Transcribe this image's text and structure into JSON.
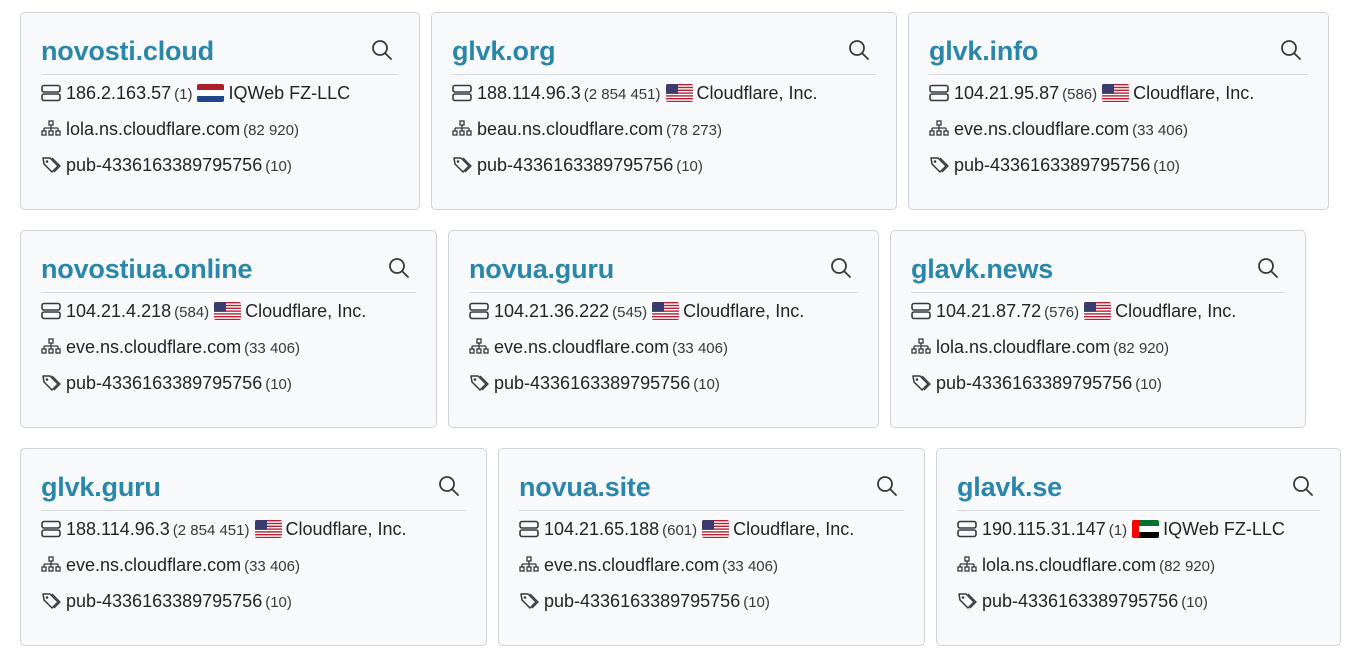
{
  "cards": [
    {
      "domain": "novosti.cloud",
      "ip": "186.2.163.57",
      "ip_count": "(1)",
      "flag": "nl-flag-icon",
      "provider": "IQWeb FZ-LLC",
      "ns": "lola.ns.cloudflare.com",
      "ns_count": "(82 920)",
      "pub": "pub-4336163389795756",
      "pub_count": "(10)"
    },
    {
      "domain": "glvk.org",
      "ip": "188.114.96.3",
      "ip_count": "(2 854 451)",
      "flag": "us-flag-icon",
      "provider": "Cloudflare, Inc.",
      "ns": "beau.ns.cloudflare.com",
      "ns_count": "(78 273)",
      "pub": "pub-4336163389795756",
      "pub_count": "(10)"
    },
    {
      "domain": "glvk.info",
      "ip": "104.21.95.87",
      "ip_count": "(586)",
      "flag": "us-flag-icon",
      "provider": "Cloudflare, Inc.",
      "ns": "eve.ns.cloudflare.com",
      "ns_count": "(33 406)",
      "pub": "pub-4336163389795756",
      "pub_count": "(10)"
    },
    {
      "domain": "novostiua.online",
      "ip": "104.21.4.218",
      "ip_count": "(584)",
      "flag": "us-flag-icon",
      "provider": "Cloudflare, Inc.",
      "ns": "eve.ns.cloudflare.com",
      "ns_count": "(33 406)",
      "pub": "pub-4336163389795756",
      "pub_count": "(10)"
    },
    {
      "domain": "novua.guru",
      "ip": "104.21.36.222",
      "ip_count": "(545)",
      "flag": "us-flag-icon",
      "provider": "Cloudflare, Inc.",
      "ns": "eve.ns.cloudflare.com",
      "ns_count": "(33 406)",
      "pub": "pub-4336163389795756",
      "pub_count": "(10)"
    },
    {
      "domain": "glavk.news",
      "ip": "104.21.87.72",
      "ip_count": "(576)",
      "flag": "us-flag-icon",
      "provider": "Cloudflare, Inc.",
      "ns": "lola.ns.cloudflare.com",
      "ns_count": "(82 920)",
      "pub": "pub-4336163389795756",
      "pub_count": "(10)"
    },
    {
      "domain": "glvk.guru",
      "ip": "188.114.96.3",
      "ip_count": "(2 854 451)",
      "flag": "us-flag-icon",
      "provider": "Cloudflare, Inc.",
      "ns": "eve.ns.cloudflare.com",
      "ns_count": "(33 406)",
      "pub": "pub-4336163389795756",
      "pub_count": "(10)"
    },
    {
      "domain": "novua.site",
      "ip": "104.21.65.188",
      "ip_count": "(601)",
      "flag": "us-flag-icon",
      "provider": "Cloudflare, Inc.",
      "ns": "eve.ns.cloudflare.com",
      "ns_count": "(33 406)",
      "pub": "pub-4336163389795756",
      "pub_count": "(10)"
    },
    {
      "domain": "glavk.se",
      "ip": "190.115.31.147",
      "ip_count": "(1)",
      "flag": "ae-flag-icon",
      "provider": "IQWeb FZ-LLC",
      "ns": "lola.ns.cloudflare.com",
      "ns_count": "(82 920)",
      "pub": "pub-4336163389795756",
      "pub_count": "(10)"
    }
  ],
  "icons": {
    "server": "server-icon",
    "ns": "sitemap-icon",
    "pub": "tag-icon",
    "search": "search-icon"
  },
  "colors": {
    "domain_link": "#2a87a9",
    "card_bg": "#f8f9fa",
    "card_border": "#cfd3d8"
  }
}
